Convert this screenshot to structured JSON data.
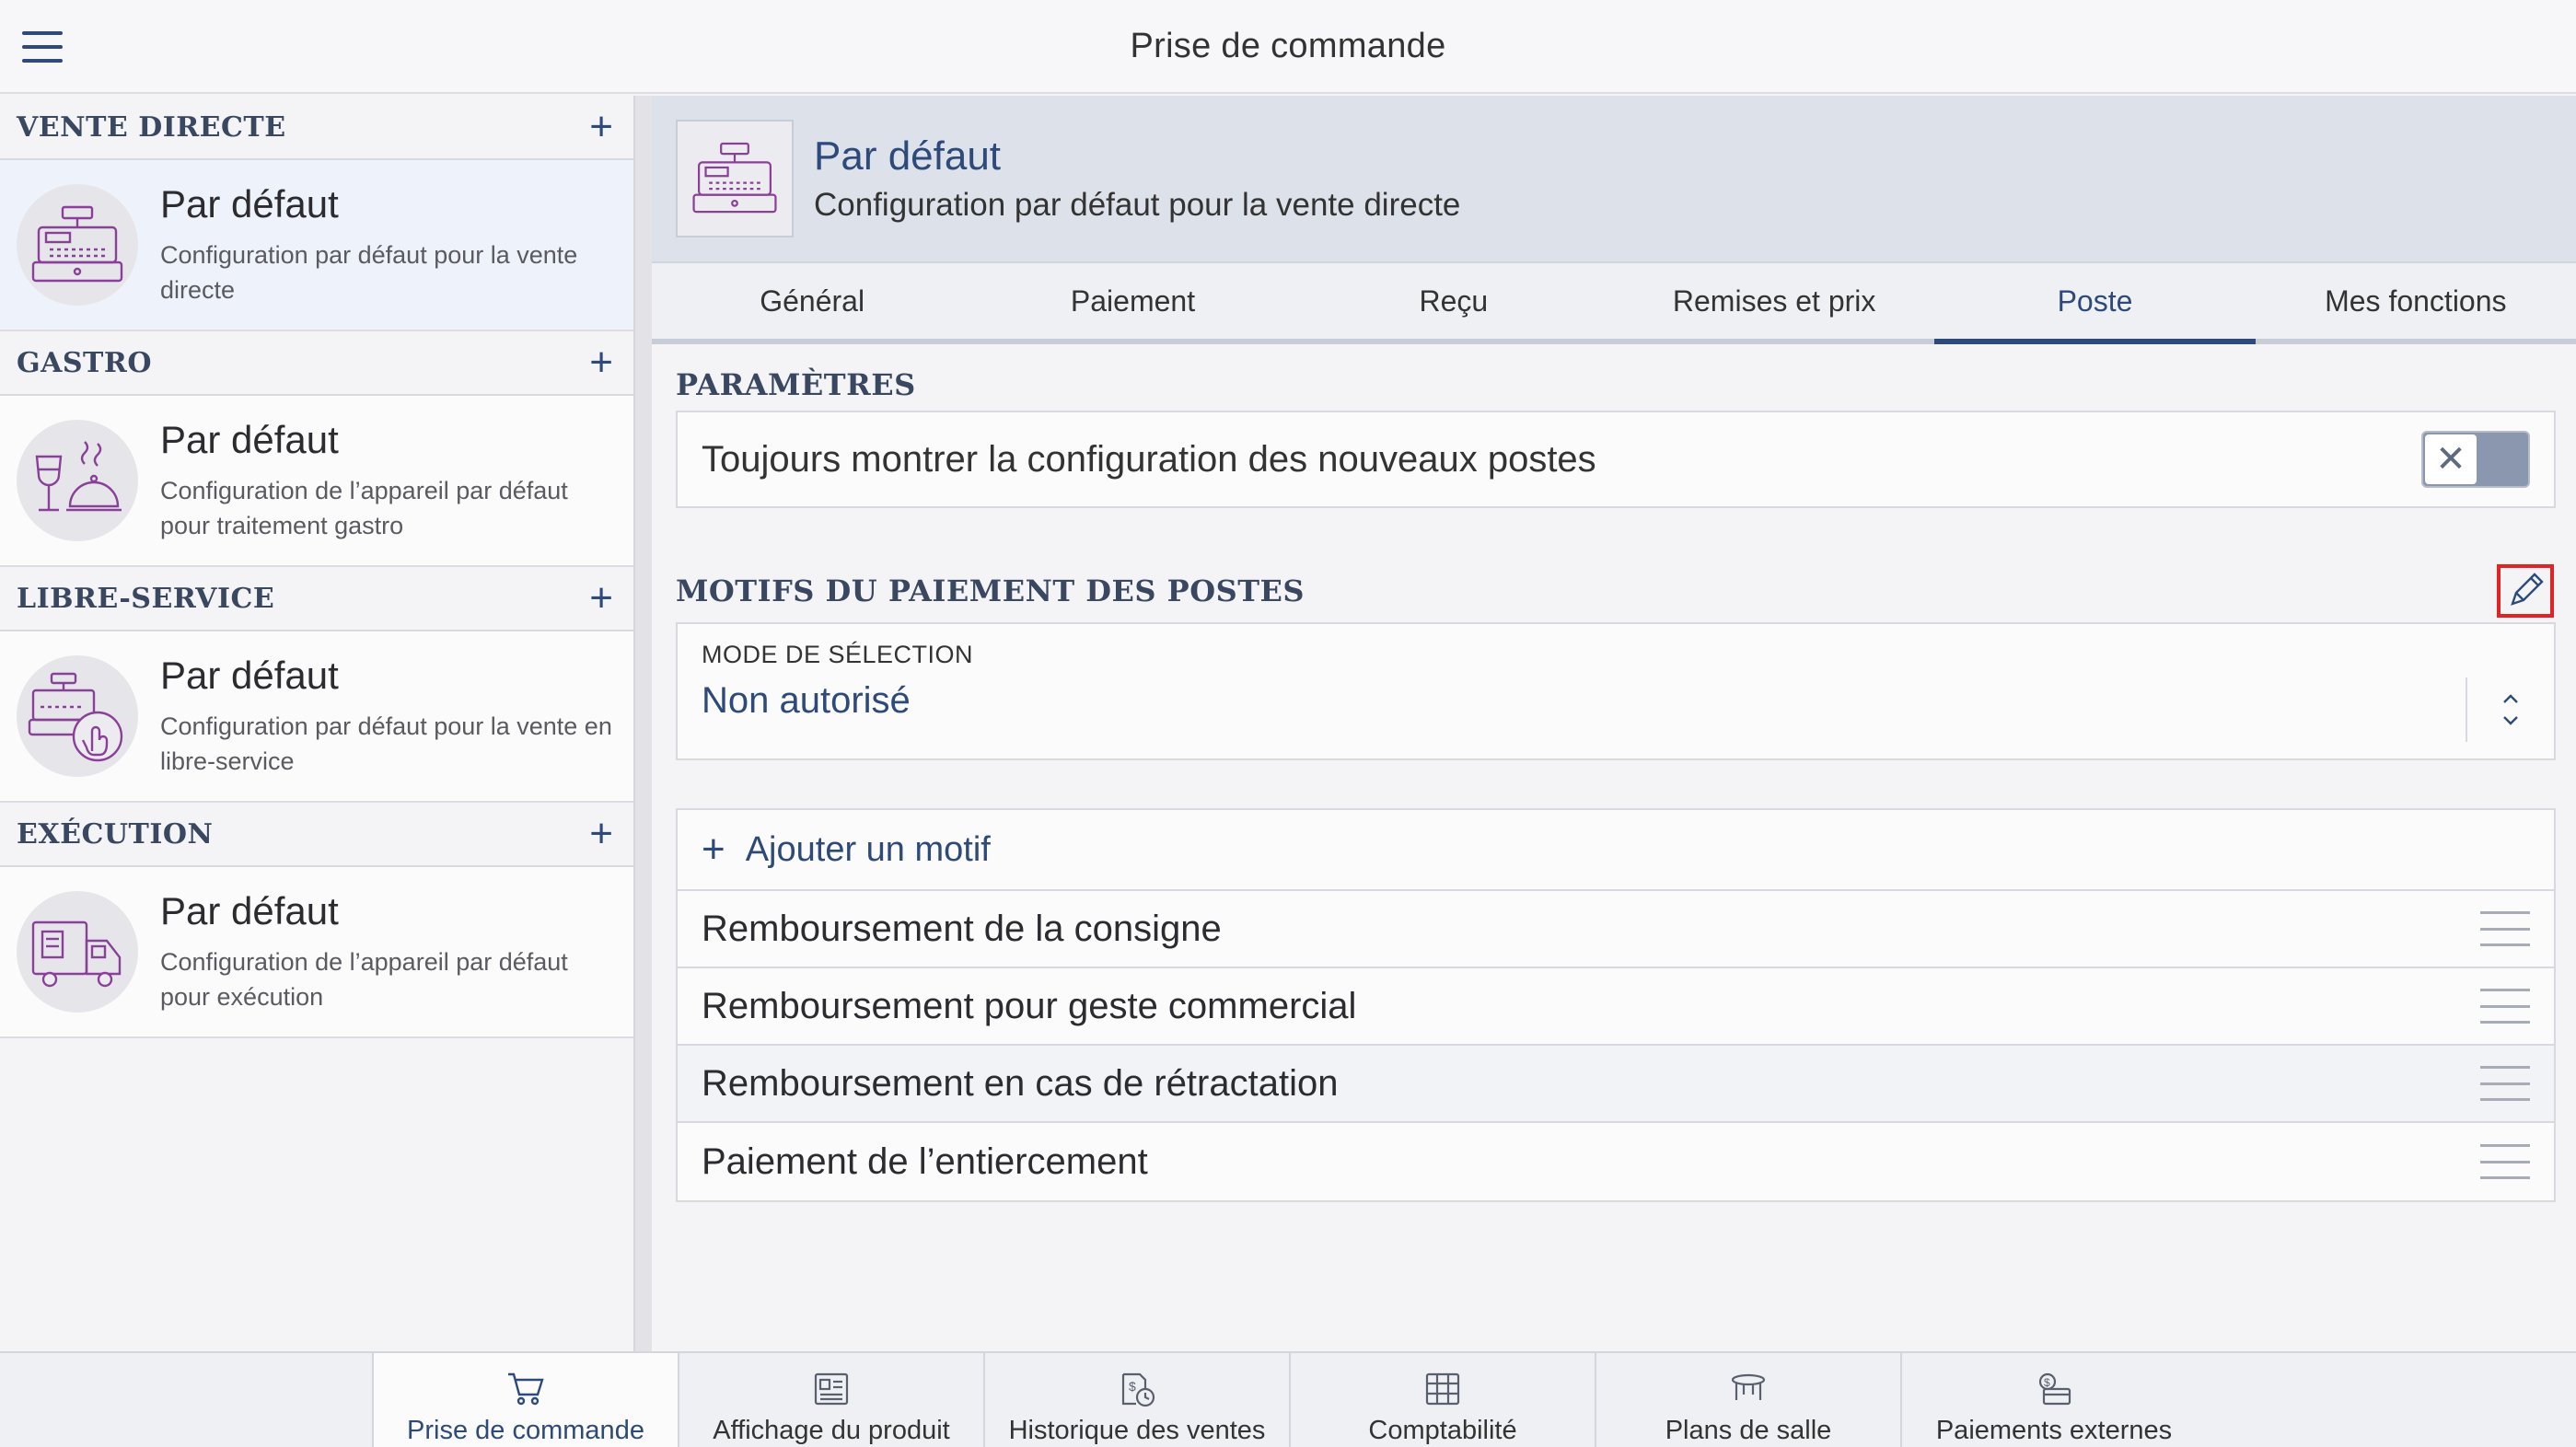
{
  "topbar": {
    "title": "Prise de commande"
  },
  "sidebar": {
    "sections": [
      {
        "title": "VENTE DIRECTE",
        "item": {
          "title": "Par défaut",
          "desc_line1": "Configuration par défaut pour la vente",
          "desc_line2": "directe",
          "icon": "cash-register-icon"
        }
      },
      {
        "title": "GASTRO",
        "item": {
          "title": "Par défaut",
          "desc_line1": "Configuration de l’appareil par défaut",
          "desc_line2": "pour traitement gastro",
          "icon": "wine-cloche-icon"
        }
      },
      {
        "title": "LIBRE-SERVICE",
        "item": {
          "title": "Par défaut",
          "desc_line1": "Configuration par défaut pour la vente en",
          "desc_line2": "libre-service",
          "icon": "self-service-register-icon"
        }
      },
      {
        "title": "EXÉCUTION",
        "item": {
          "title": "Par défaut",
          "desc_line1": "Configuration de l’appareil par défaut",
          "desc_line2": "pour exécution",
          "icon": "delivery-truck-icon"
        }
      }
    ],
    "add_symbol": "+"
  },
  "main": {
    "header": {
      "title": "Par défaut",
      "subtitle": "Configuration par défaut pour la vente directe",
      "icon": "cash-register-icon"
    },
    "tabs": [
      {
        "label": "Général"
      },
      {
        "label": "Paiement"
      },
      {
        "label": "Reçu"
      },
      {
        "label": "Remises et prix"
      },
      {
        "label": "Poste",
        "active": true
      },
      {
        "label": "Mes fonctions"
      }
    ],
    "parametres": {
      "title": "PARAMÈTRES",
      "setting_label": "Toujours montrer la configuration des nouveaux postes",
      "toggle_state": "off",
      "toggle_symbol": "✕"
    },
    "motifs": {
      "title": "MOTIFS DU PAIEMENT DES POSTES",
      "select_label": "MODE DE SÉLECTION",
      "select_value": "Non autorisé",
      "add_symbol": "+",
      "add_label": "Ajouter un motif",
      "items": [
        "Remboursement de la consigne",
        "Remboursement pour geste commercial",
        "Remboursement en cas de rétractation",
        "Paiement de l’entiercement"
      ]
    }
  },
  "bottom_nav": [
    {
      "label": "Prise de commande",
      "icon": "cart-icon",
      "active": true
    },
    {
      "label": "Affichage du produit",
      "icon": "product-display-icon"
    },
    {
      "label": "Historique des ventes",
      "icon": "sales-history-icon"
    },
    {
      "label": "Comptabilité",
      "icon": "accounting-icon"
    },
    {
      "label": "Plans de salle",
      "icon": "table-icon"
    },
    {
      "label": "Paiements externes",
      "icon": "external-payment-icon"
    }
  ],
  "colors": {
    "accent": "#2d4a7a",
    "icon_purple": "#8a3f98",
    "highlight_red": "#e02323"
  }
}
